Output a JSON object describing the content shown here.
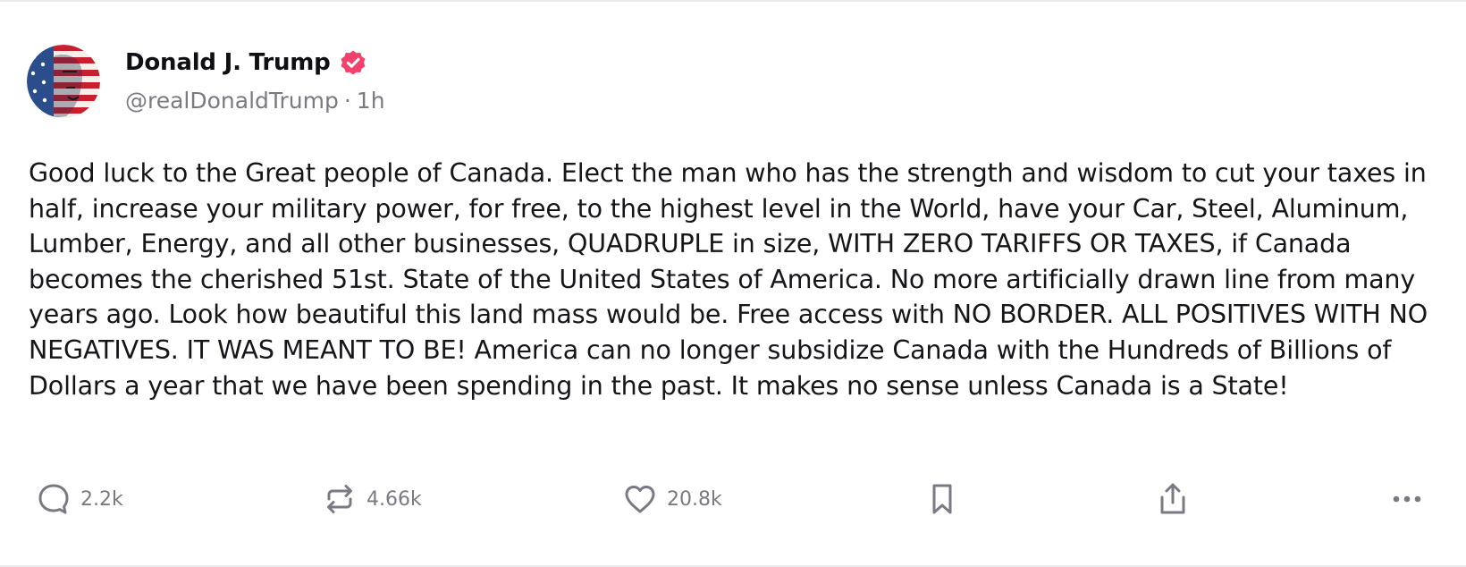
{
  "post": {
    "author_name": "Donald J. Trump",
    "handle": "@realDonaldTrump",
    "separator": "·",
    "time": "1h",
    "verified_color": "#f2416b",
    "avatar": "flag-face-avatar",
    "text": "Good luck to the Great people of Canada. Elect the man who has the strength and wisdom to cut your taxes in half, increase your military power, for free, to the highest level in the World, have your Car, Steel, Aluminum, Lumber, Energy, and all other businesses, QUADRUPLE in size, WITH ZERO TARIFFS OR TAXES, if Canada becomes the cherished 51st. State of the United States of America. No more artificially drawn line from many years ago. Look how beautiful this land mass would be. Free access with NO BORDER. ALL POSITIVES WITH NO NEGATIVES. IT WAS MEANT TO BE! America can no longer subsidize Canada with the Hundreds of Billions of Dollars a year that we have been spending in the past. It makes no sense unless Canada is a State!"
  },
  "actions": {
    "reply": {
      "icon": "comment-icon",
      "count": "2.2k"
    },
    "repost": {
      "icon": "repost-icon",
      "count": "4.66k"
    },
    "like": {
      "icon": "heart-icon",
      "count": "20.8k"
    },
    "bookmark": {
      "icon": "bookmark-icon"
    },
    "share": {
      "icon": "share-icon"
    },
    "more": {
      "icon": "more-icon"
    }
  },
  "colors": {
    "text": "#15151a",
    "muted": "#7a7a85",
    "verified": "#f2416b",
    "border": "#e9e9ee"
  }
}
